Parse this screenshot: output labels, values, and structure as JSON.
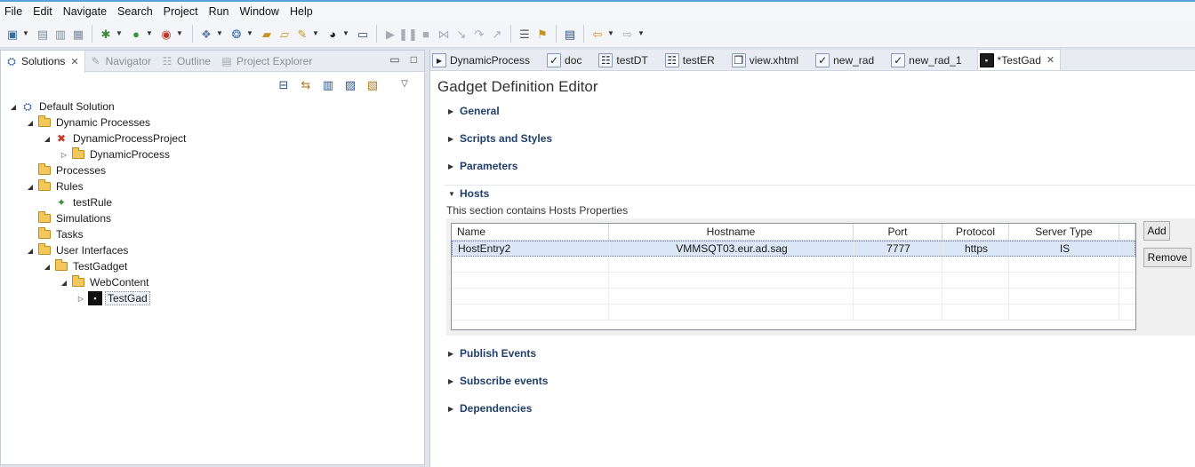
{
  "menu": [
    "File",
    "Edit",
    "Navigate",
    "Search",
    "Project",
    "Run",
    "Window",
    "Help"
  ],
  "left_tabs": [
    {
      "label": "Solutions",
      "active": true
    },
    {
      "label": "Navigator",
      "active": false
    },
    {
      "label": "Outline",
      "active": false
    },
    {
      "label": "Project Explorer",
      "active": false
    }
  ],
  "tree": [
    {
      "label": "Default Solution",
      "level": 0,
      "twisty": "expanded",
      "icon": "solution-icon"
    },
    {
      "label": "Dynamic Processes",
      "level": 1,
      "twisty": "expanded",
      "icon": "folder-icon"
    },
    {
      "label": "DynamicProcessProject",
      "level": 2,
      "twisty": "expanded",
      "icon": "process-project-icon"
    },
    {
      "label": "DynamicProcess",
      "level": 3,
      "twisty": "collapsed",
      "icon": "folder-icon"
    },
    {
      "label": "Processes",
      "level": 1,
      "twisty": "none",
      "icon": "folder-icon"
    },
    {
      "label": "Rules",
      "level": 1,
      "twisty": "expanded",
      "icon": "folder-icon"
    },
    {
      "label": "testRule",
      "level": 2,
      "twisty": "none",
      "icon": "rule-icon"
    },
    {
      "label": "Simulations",
      "level": 1,
      "twisty": "none",
      "icon": "folder-icon"
    },
    {
      "label": "Tasks",
      "level": 1,
      "twisty": "none",
      "icon": "folder-icon"
    },
    {
      "label": "User Interfaces",
      "level": 1,
      "twisty": "expanded",
      "icon": "folder-icon"
    },
    {
      "label": "TestGadget",
      "level": 2,
      "twisty": "expanded",
      "icon": "folder-icon"
    },
    {
      "label": "WebContent",
      "level": 3,
      "twisty": "expanded",
      "icon": "folder-icon"
    },
    {
      "label": "TestGad",
      "level": 4,
      "twisty": "collapsed",
      "icon": "gadget-icon",
      "selected": true
    }
  ],
  "editor_tabs": [
    {
      "label": "DynamicProcess",
      "icon": "process-icon"
    },
    {
      "label": "doc",
      "icon": "doc-icon"
    },
    {
      "label": "testDT",
      "icon": "table-icon"
    },
    {
      "label": "testER",
      "icon": "table-icon"
    },
    {
      "label": "view.xhtml",
      "icon": "xhtml-icon"
    },
    {
      "label": "new_rad",
      "icon": "rad-icon"
    },
    {
      "label": "new_rad_1",
      "icon": "rad-icon"
    },
    {
      "label": "*TestGad",
      "icon": "gadget-icon",
      "active": true
    }
  ],
  "editor": {
    "title": "Gadget Definition Editor",
    "sections": {
      "general": "General",
      "scripts": "Scripts and Styles",
      "parameters": "Parameters",
      "hosts": "Hosts",
      "publish": "Publish Events",
      "subscribe": "Subscribe events",
      "dependencies": "Dependencies"
    },
    "hosts_description": "This section contains Hosts Properties",
    "hosts_columns": [
      "Name",
      "Hostname",
      "Port",
      "Protocol",
      "Server Type"
    ],
    "hosts_rows": [
      [
        "HostEntry2",
        "VMMSQT03.eur.ad.sag",
        "7777",
        "https",
        "IS"
      ]
    ],
    "add_button": "Add",
    "remove_button": "Remove"
  }
}
